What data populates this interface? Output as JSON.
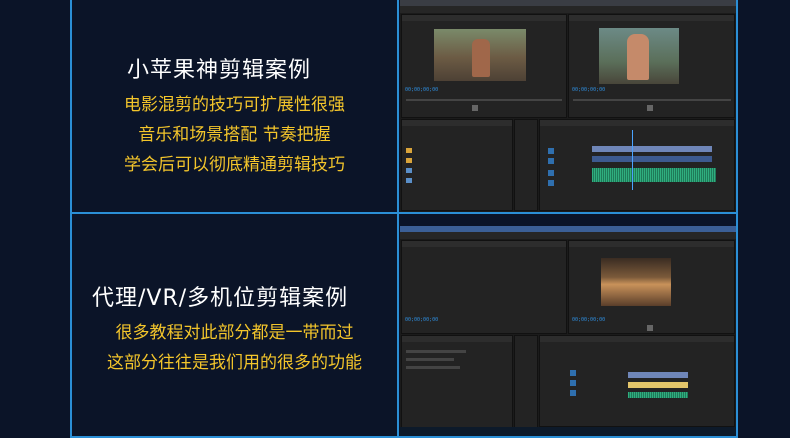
{
  "sections": [
    {
      "title": "小苹果神剪辑案例",
      "lines": [
        "电影混剪的技巧可扩展性很强",
        "音乐和场景搭配  节奏把握",
        "学会后可以彻底精通剪辑技巧"
      ]
    },
    {
      "title": "代理/VR/多机位剪辑案例",
      "lines": [
        "很多教程对此部分都是一带而过",
        "这部分往往是我们用的很多的功能"
      ]
    }
  ],
  "colors": {
    "border": "#2b8fd6",
    "accent_text": "#f3c52b",
    "background": "#0b1428",
    "timecode": "#2f8fe0",
    "audio_wave": "#2fae7f"
  }
}
